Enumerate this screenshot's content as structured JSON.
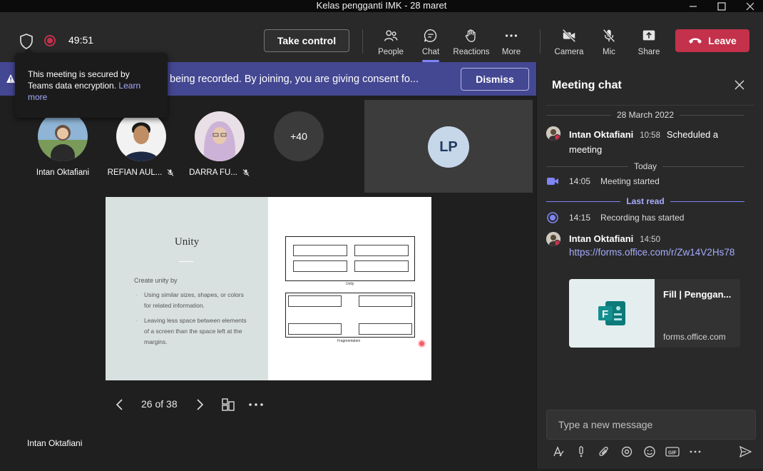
{
  "window": {
    "title": "Kelas pengganti IMK - 28 maret"
  },
  "toolbar": {
    "timer": "49:51",
    "take_control": "Take control",
    "people": "People",
    "chat": "Chat",
    "reactions": "Reactions",
    "more": "More",
    "camera": "Camera",
    "mic": "Mic",
    "share": "Share",
    "leave": "Leave"
  },
  "banner": {
    "text": "eeting is being recorded. By joining, you are giving consent fo...",
    "dismiss": "Dismiss"
  },
  "tooltip": {
    "text": "This meeting is secured by Teams data encryption.",
    "link": "Learn more"
  },
  "participants": [
    {
      "name": "Intan Oktafiani",
      "muted": false
    },
    {
      "name": "REFIAN AUL...",
      "muted": true
    },
    {
      "name": "DARRA FU...",
      "muted": true
    }
  ],
  "overflow_count": "+40",
  "lp_tile": {
    "initials": "LP"
  },
  "slide": {
    "title": "Unity",
    "subtitle": "Create unity by",
    "bullet1": "Using similar sizes, shapes, or colors for related information.",
    "bullet2": "Leaving less space between elements of a screen than the space left at the margins.",
    "caption_top": "Unity",
    "caption_bottom": "Fragmentation"
  },
  "slide_nav": {
    "page": "26 of 38"
  },
  "presenter": {
    "name": "Intan Oktafiani"
  },
  "chat": {
    "title": "Meeting chat",
    "date1": "28 March 2022",
    "msg1": {
      "name": "Intan Oktafiani",
      "time": "10:58",
      "text_a": "Scheduled a",
      "text_b": "meeting"
    },
    "date2": "Today",
    "sys1": {
      "time": "14:05",
      "text": "Meeting started"
    },
    "last_read": "Last read",
    "sys2": {
      "time": "14:15",
      "text": "Recording has started"
    },
    "msg2": {
      "name": "Intan Oktafiani",
      "time": "14:50",
      "link": "https://forms.office.com/r/Zw14V2Hs78"
    },
    "card": {
      "title": "Fill | Penggan...",
      "url": "forms.office.com"
    },
    "compose_placeholder": "Type a new message"
  },
  "colors": {
    "accent": "#7f85f5",
    "leave": "#c4314b",
    "banner": "#444791"
  }
}
